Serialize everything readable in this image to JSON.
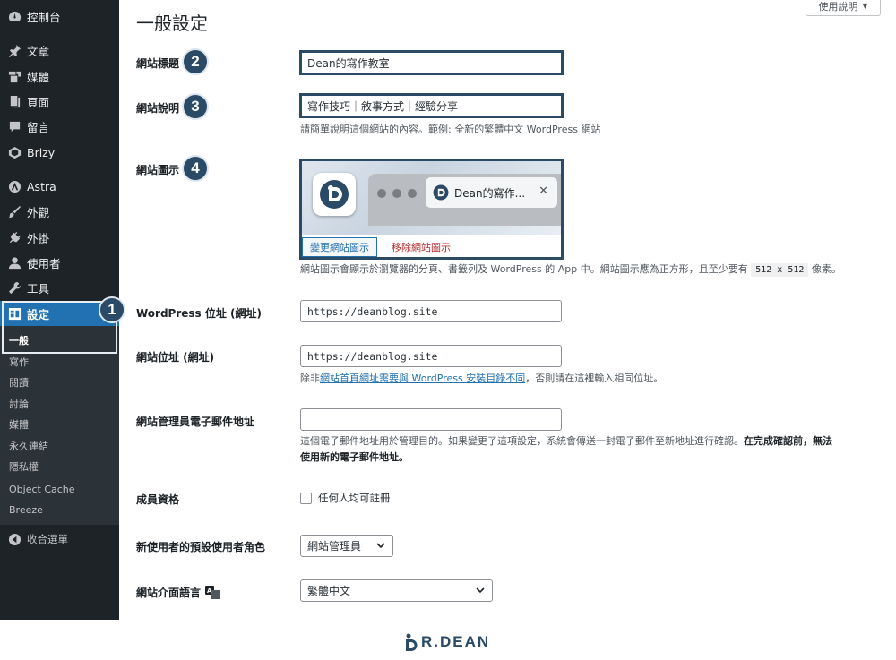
{
  "sidebar": {
    "menu": [
      {
        "label": "控制台",
        "icon": "dashboard-icon"
      },
      {
        "label": "文章",
        "icon": "pin-icon"
      },
      {
        "label": "媒體",
        "icon": "media-icon"
      },
      {
        "label": "頁面",
        "icon": "page-icon"
      },
      {
        "label": "留言",
        "icon": "comment-icon"
      },
      {
        "label": "Brizy",
        "icon": "brizy-icon"
      },
      {
        "label": "Astra",
        "icon": "astra-icon"
      },
      {
        "label": "外觀",
        "icon": "brush-icon"
      },
      {
        "label": "外掛",
        "icon": "plugin-icon"
      },
      {
        "label": "使用者",
        "icon": "user-icon"
      },
      {
        "label": "工具",
        "icon": "wrench-icon"
      },
      {
        "label": "設定",
        "icon": "settings-icon"
      }
    ],
    "submenu": [
      "一般",
      "寫作",
      "閱讀",
      "討論",
      "媒體",
      "永久連結",
      "隱私權",
      "Object Cache",
      "Breeze"
    ],
    "collapse_label": "收合選單"
  },
  "badges": [
    "1",
    "2",
    "3",
    "4"
  ],
  "header": {
    "title": "一般設定",
    "help_label": "使用說明"
  },
  "form": {
    "site_title": {
      "label": "網站標題",
      "value": "Dean的寫作教室"
    },
    "tagline": {
      "label": "網站說明",
      "value": "寫作技巧｜敘事方式｜經驗分享",
      "desc": "請簡單說明這個網站的內容。範例: 全新的繁體中文 WordPress 網站"
    },
    "site_icon": {
      "label": "網站圖示",
      "tab_title": "Dean的寫作...",
      "change_label": "變更網站圖示",
      "remove_label": "移除網站圖示",
      "desc_before": "網站圖示會顯示於瀏覽器的分頁、書籤列及 WordPress 的 App 中。網站圖示應為正方形，且至少要有",
      "desc_code": "512 x 512",
      "desc_after": "像素。"
    },
    "wp_address": {
      "label": "WordPress 位址 (網址)",
      "value": "https://deanblog.site"
    },
    "site_address": {
      "label": "網站位址 (網址)",
      "value": "https://deanblog.site",
      "desc_before": "除非",
      "desc_link": "網站首頁網址需要與 WordPress 安裝目錄不同",
      "desc_after": "，否則請在這裡輸入相同位址。"
    },
    "admin_email": {
      "label": "網站管理員電子郵件地址",
      "value": "",
      "desc_line1_normal": "這個電子郵件地址用於管理目的。如果變更了這項設定，系統會傳送一封電子郵件至新地址進行確認。",
      "desc_line1_bold": "在完成確認前，無法",
      "desc_line2_bold": "使用新的電子郵件地址。"
    },
    "membership": {
      "label": "成員資格",
      "checkbox_label": "任何人均可註冊",
      "checked": false
    },
    "default_role": {
      "label": "新使用者的預設使用者角色",
      "value": "網站管理員"
    },
    "site_language": {
      "label": "網站介面語言",
      "value": "繁體中文"
    }
  },
  "footer": {
    "logo_text": "R.DEAN"
  },
  "colors": {
    "accent": "#2271b1",
    "sidebar_bg": "#1d2327",
    "badge": "#2b4a66",
    "danger": "#b32d2e"
  }
}
